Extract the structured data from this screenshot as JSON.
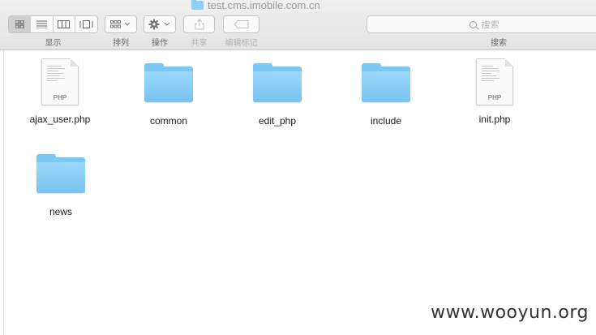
{
  "window": {
    "title": "test.cms.imobile.com.cn"
  },
  "toolbar": {
    "view_label": "显示",
    "arrange_label": "排列",
    "action_label": "操作",
    "share_label": "共享",
    "tags_label": "编辑标记",
    "search_label": "搜索",
    "search_placeholder": "搜索"
  },
  "files": [
    {
      "name": "ajax_user.php",
      "kind": "php",
      "badge": "PHP"
    },
    {
      "name": "common",
      "kind": "folder"
    },
    {
      "name": "edit_php",
      "kind": "folder"
    },
    {
      "name": "include",
      "kind": "folder"
    },
    {
      "name": "init.php",
      "kind": "php",
      "badge": "PHP"
    },
    {
      "name": "news",
      "kind": "folder"
    }
  ],
  "watermark": "www.wooyun.org",
  "icons": [
    "folder-icon",
    "php-file-icon",
    "icon-view-icon",
    "list-view-icon",
    "column-view-icon",
    "cover-flow-icon",
    "arrange-icon",
    "gear-icon",
    "share-icon",
    "tag-icon",
    "search-icon"
  ]
}
